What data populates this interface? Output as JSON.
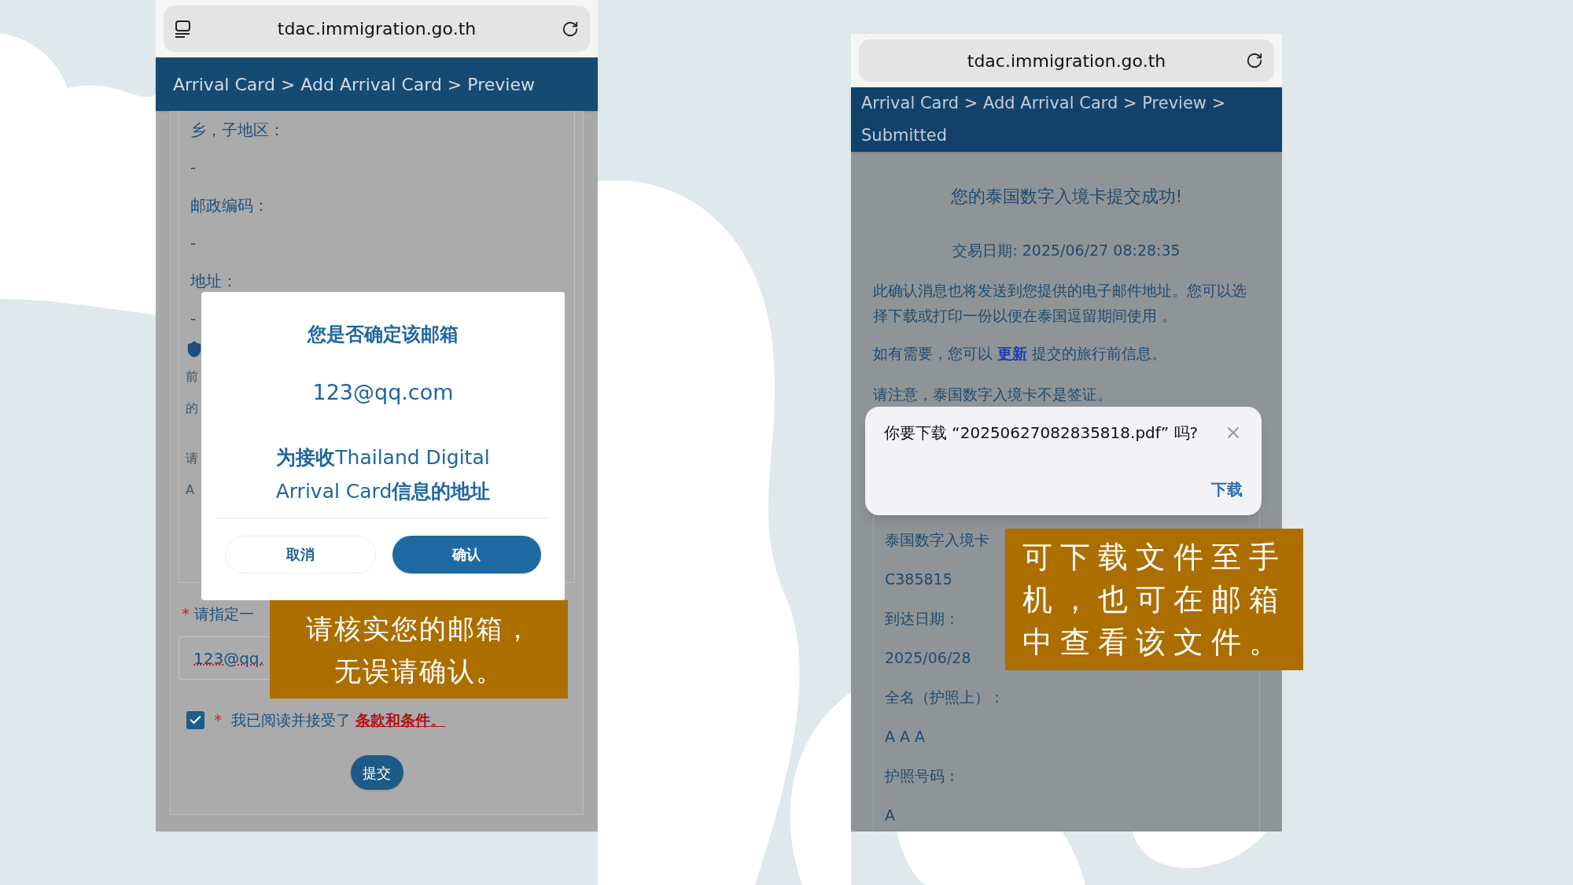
{
  "left_phone": {
    "address_bar": {
      "url": "tdac.immigration.go.th"
    },
    "breadcrumb": "Arrival Card > Add Arrival Card > Preview",
    "fields": [
      {
        "label": "乡，子地区：",
        "value": "-"
      },
      {
        "label": "邮政编码：",
        "value": "-"
      },
      {
        "label": "地址：",
        "value": "-"
      }
    ],
    "partial_lines": [
      "前",
      "的",
      "请",
      "A"
    ],
    "confirm_dialog": {
      "title": "您是否确定该邮箱",
      "email": "123@qq.com",
      "message_lines": [
        "**为接收**Thailand Digital",
        "Arrival Card**信息的地址**"
      ],
      "buttons": [
        {
          "label": "取消",
          "kind": "secondary"
        },
        {
          "label": "确认",
          "kind": "primary"
        }
      ]
    },
    "email_prompt": {
      "required_mark": "*",
      "label": "请指定一"
    },
    "email_field": {
      "value": "123@qq."
    },
    "terms": {
      "checked": true,
      "required_mark": "*",
      "text": "我已阅读并接受了",
      "link": "条款和条件。"
    },
    "submit_button": "提交",
    "callout_lines": [
      "请核实您的邮箱，",
      "无误请确认。"
    ]
  },
  "right_phone": {
    "address_bar": {
      "url": "tdac.immigration.go.th"
    },
    "breadcrumb_lines": [
      "Arrival Card > Add Arrival Card > Preview >",
      "Submitted"
    ],
    "success_title": "您的泰国数字入境卡提交成功!",
    "transaction_date": "交易日期: 2025/06/27 08:28:35",
    "confirmation_text": "此确认消息也将发送到您提供的电子邮件地址。您可以选择下载或打印一份以便在泰国逗留期间使用 。",
    "update_notice": {
      "before": "如有需要，您可以",
      "link": "更新",
      "after": "提交的旅行前信息。"
    },
    "visa_note": "请注意，泰国数字入境卡不是签证。",
    "download_dialog": {
      "message": "你要下载 “20250627082835818.pdf” 吗?",
      "action": "下载"
    },
    "fields": [
      {
        "label": "泰国数字入境卡",
        "value": "C385815"
      },
      {
        "label": "到达日期：",
        "value": "2025/06/28"
      },
      {
        "label": "全名（护照上）：",
        "value": "A A A"
      },
      {
        "label": "护照号码：",
        "value": "A"
      }
    ],
    "callout_lines": [
      "可下载文件至手",
      "机，也可在邮箱",
      "中查看该文件。"
    ]
  }
}
